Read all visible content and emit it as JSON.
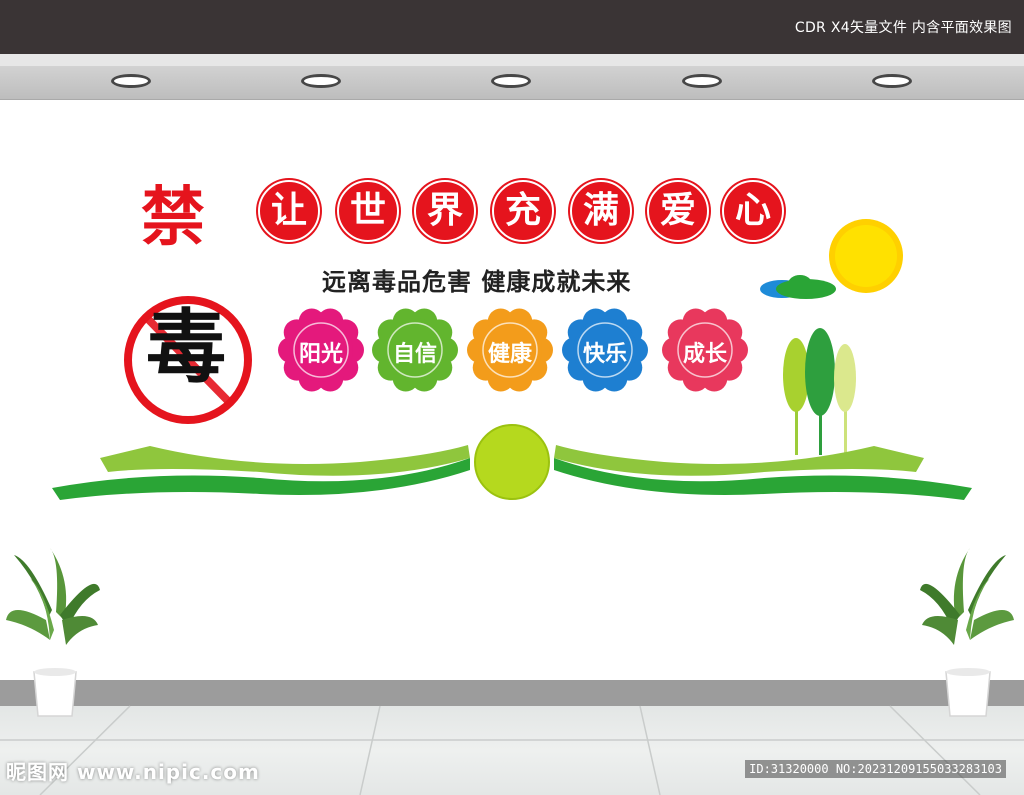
{
  "header": {
    "caption": "CDR X4矢量文件  内含平面效果图"
  },
  "sign": {
    "forbid_char": "禁",
    "drug_char": "毒",
    "title_chars": [
      "让",
      "世",
      "界",
      "充",
      "满",
      "爱",
      "心"
    ],
    "slogan": "远离毒品危害  健康成就未来",
    "flowers": [
      {
        "label": "阳光",
        "color": "#e4197c"
      },
      {
        "label": "自信",
        "color": "#62b52e"
      },
      {
        "label": "健康",
        "color": "#f39c1b"
      },
      {
        "label": "快乐",
        "color": "#1e7fd1"
      },
      {
        "label": "成长",
        "color": "#e8385d"
      }
    ],
    "accent_red": "#e5141d",
    "sun_color": "#ffe100"
  },
  "watermark": {
    "left": "昵图网 www.nipic.com",
    "right": "ID:31320000 NO:20231209155033283103"
  }
}
